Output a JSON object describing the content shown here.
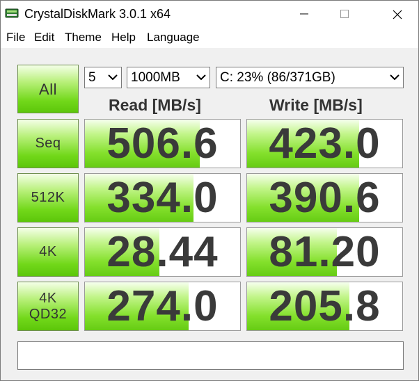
{
  "window": {
    "title": "CrystalDiskMark 3.0.1 x64",
    "icon": "disk-icon",
    "controls": [
      "minimize-icon",
      "maximize-icon",
      "close-icon"
    ]
  },
  "menu": {
    "file": "File",
    "edit": "Edit",
    "theme": "Theme",
    "help": "Help",
    "language": "Language"
  },
  "controls": {
    "all_label": "All",
    "count": "5",
    "size": "1000MB",
    "drive": "C: 23% (86/371GB)"
  },
  "headers": {
    "read": "Read [MB/s]",
    "write": "Write [MB/s]"
  },
  "tests": [
    {
      "label_line1": "Seq",
      "label_line2": "",
      "read": "506.6",
      "write": "423.0",
      "read_fill": 0.74,
      "write_fill": 0.72
    },
    {
      "label_line1": "512K",
      "label_line2": "",
      "read": "334.0",
      "write": "390.6",
      "read_fill": 0.7,
      "write_fill": 0.72
    },
    {
      "label_line1": "4K",
      "label_line2": "",
      "read": "28.44",
      "write": "81.20",
      "read_fill": 0.48,
      "write_fill": 0.58
    },
    {
      "label_line1": "4K",
      "label_line2": "QD32",
      "read": "274.0",
      "write": "205.8",
      "read_fill": 0.67,
      "write_fill": 0.66
    }
  ],
  "comment": "",
  "colors": {
    "accent_green": "#66cc14",
    "value_text": "#3a3a3a"
  }
}
